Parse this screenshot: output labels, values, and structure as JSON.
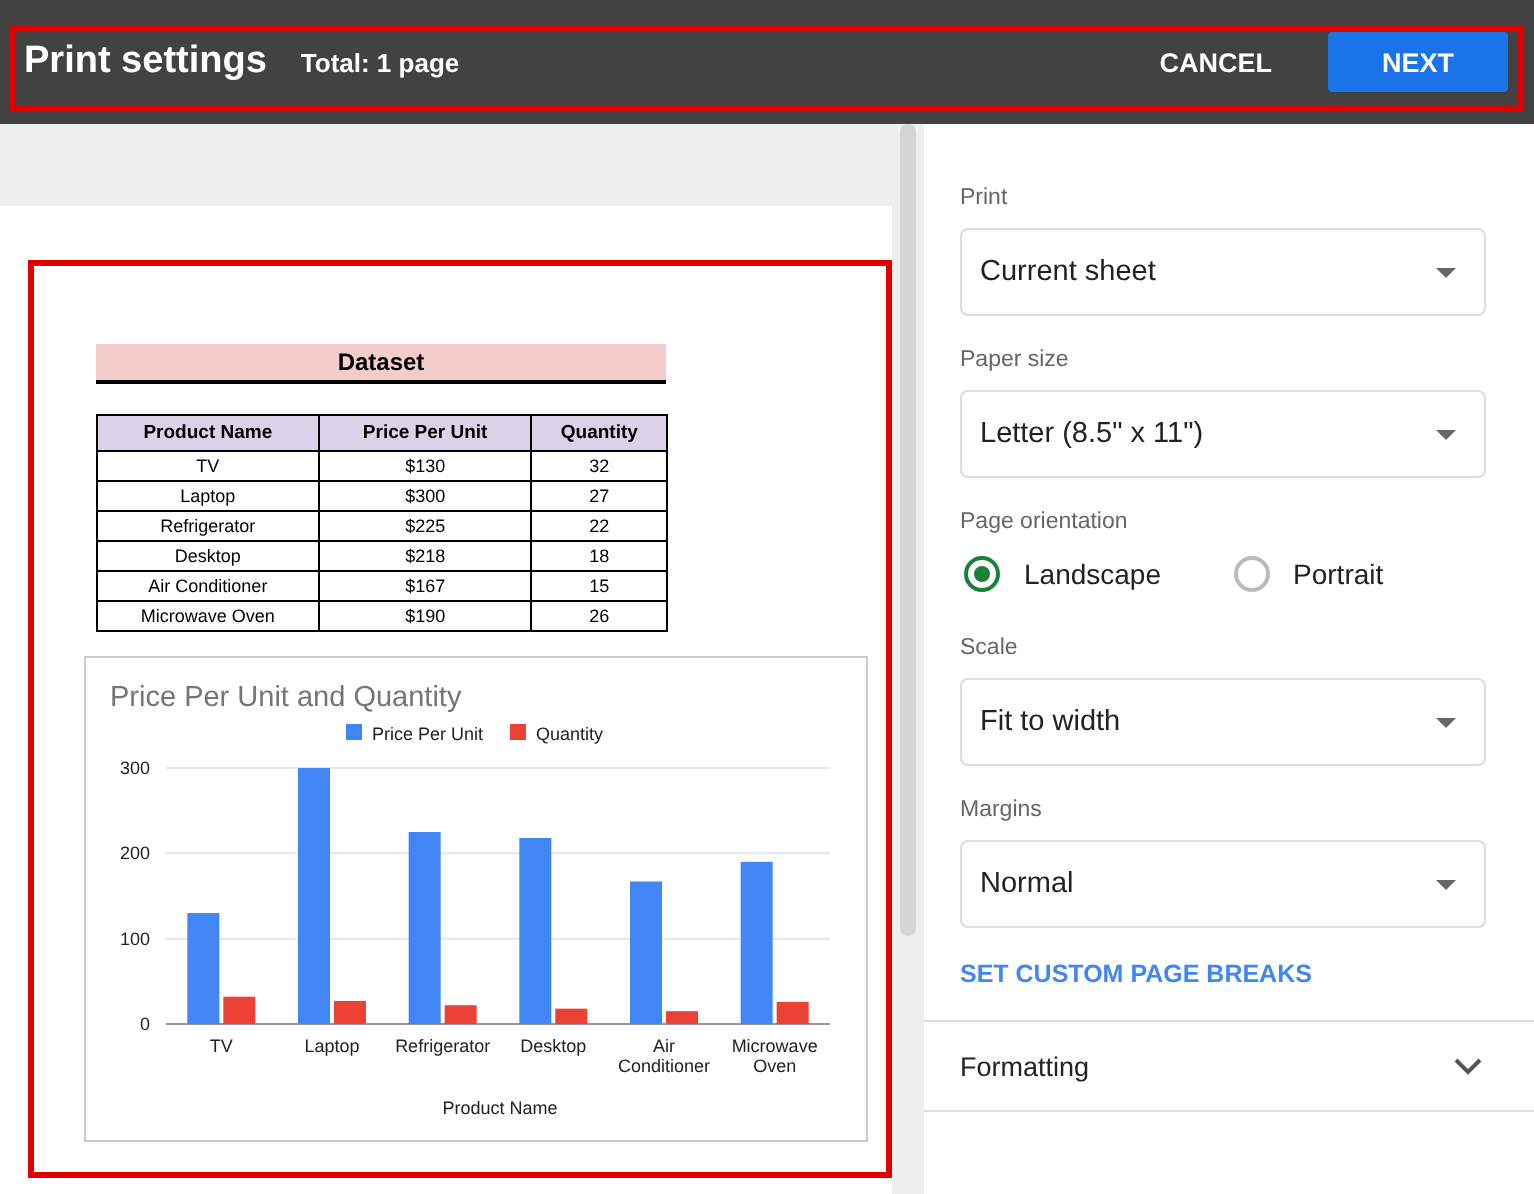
{
  "header": {
    "title": "Print settings",
    "total": "Total: 1 page",
    "buttons": [
      {
        "label": "CANCEL",
        "kind": "text"
      },
      {
        "label": "NEXT",
        "kind": "primary"
      }
    ]
  },
  "preview": {
    "dataset_title": "Dataset",
    "table": {
      "columns": [
        "Product Name",
        "Price Per Unit",
        "Quantity"
      ],
      "rows": [
        [
          "TV",
          "$130",
          "32"
        ],
        [
          "Laptop",
          "$300",
          "27"
        ],
        [
          "Refrigerator",
          "$225",
          "22"
        ],
        [
          "Desktop",
          "$218",
          "18"
        ],
        [
          "Air Conditioner",
          "$167",
          "15"
        ],
        [
          "Microwave Oven",
          "$190",
          "26"
        ]
      ]
    },
    "chart_data": {
      "type": "bar",
      "title": "Price Per Unit and Quantity",
      "xlabel": "Product Name",
      "categories": [
        "TV",
        "Laptop",
        "Refrigerator",
        "Desktop",
        "Air Conditioner",
        "Microwave Oven"
      ],
      "series": [
        {
          "name": "Price Per Unit",
          "color": "#4285f4",
          "values": [
            130,
            300,
            225,
            218,
            167,
            190
          ]
        },
        {
          "name": "Quantity",
          "color": "#ea4335",
          "values": [
            32,
            27,
            22,
            18,
            15,
            26
          ]
        }
      ],
      "legend": "top",
      "ylim": [
        0,
        300
      ],
      "yticks": [
        0,
        100,
        200,
        300
      ]
    }
  },
  "settings": {
    "sections": [
      {
        "kind": "select",
        "label": "Print",
        "value": "Current sheet"
      },
      {
        "kind": "select",
        "label": "Paper size",
        "value": "Letter (8.5\" x 11\")"
      },
      {
        "kind": "radio",
        "label": "Page orientation",
        "options": [
          {
            "label": "Landscape",
            "selected": true
          },
          {
            "label": "Portrait",
            "selected": false
          }
        ]
      },
      {
        "kind": "select",
        "label": "Scale",
        "value": "Fit to width"
      },
      {
        "kind": "select",
        "label": "Margins",
        "value": "Normal"
      }
    ],
    "link": "SET CUSTOM PAGE BREAKS",
    "accordion": {
      "label": "Formatting",
      "expanded": false
    }
  }
}
